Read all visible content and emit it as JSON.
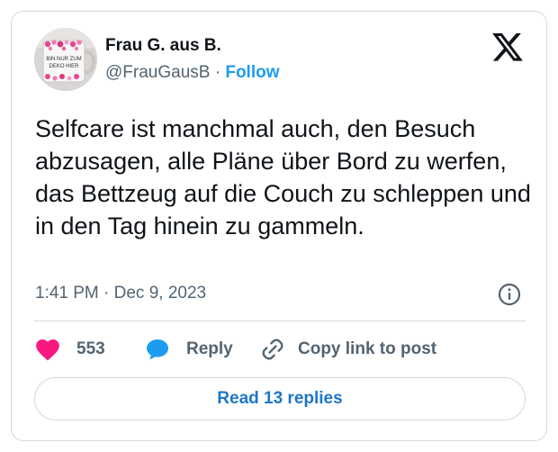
{
  "author": {
    "name": "Frau G. aus B.",
    "handle": "@FrauGausB",
    "separator": "·",
    "follow_label": "Follow",
    "avatar_mug_text": [
      "BIN NUR ZUM",
      "DEKO HIER"
    ]
  },
  "tweet": {
    "text": "Selfcare ist manchmal auch, den Besuch abzusagen, alle Pläne über Bord zu werfen, das Bettzeug auf die Couch zu schleppen und in den Tag hinein zu gammeln.",
    "timestamp": "1:41 PM · Dec 9, 2023"
  },
  "actions": {
    "like_count": "553",
    "reply_label": "Reply",
    "copy_label": "Copy link to post"
  },
  "footer": {
    "read_replies_label": "Read 13 replies"
  },
  "icons": {
    "logo": "x-logo-icon",
    "info": "info-icon",
    "like": "heart-icon",
    "reply": "speech-bubble-icon",
    "copy": "link-icon"
  },
  "colors": {
    "accent": "#1d9bf0",
    "like": "#f91880",
    "text": "#0f1419",
    "muted": "#536471",
    "border": "#cfd9de"
  }
}
